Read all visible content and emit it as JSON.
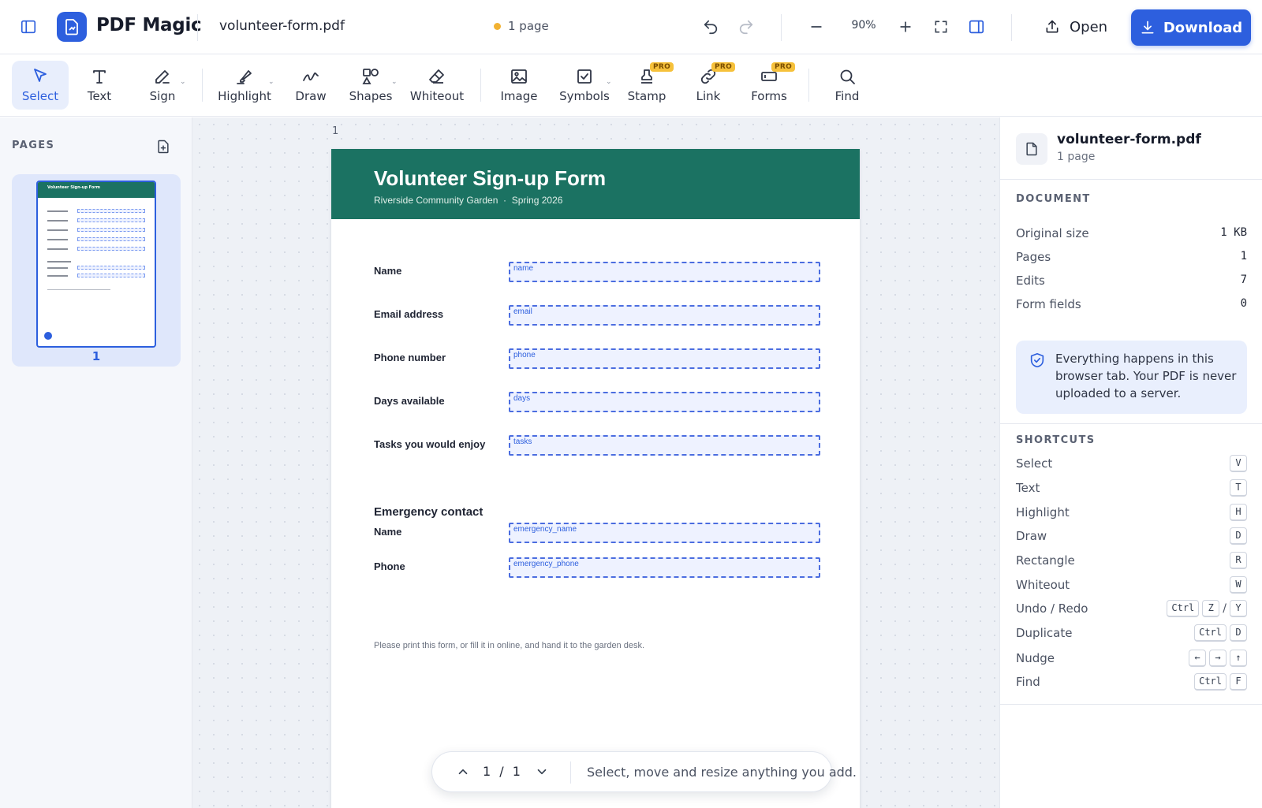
{
  "app": {
    "name": "PDF Magic"
  },
  "header": {
    "file_name": "volunteer-form.pdf",
    "page_status": "1 page",
    "zoom_level": "90%",
    "open_label": "Open",
    "download_label": "Download",
    "status_color": "#f2b232",
    "accent_color": "#2d5fde"
  },
  "toolbar": {
    "tools": [
      {
        "label": "Select",
        "icon": "cursor-icon"
      },
      {
        "label": "Text",
        "icon": "text-icon"
      },
      {
        "label": "Sign",
        "icon": "pen-icon"
      },
      {
        "label": "Highlight",
        "icon": "highlighter-icon"
      },
      {
        "label": "Draw",
        "icon": "squiggle-icon"
      },
      {
        "label": "Shapes",
        "icon": "shapes-icon"
      },
      {
        "label": "Whiteout",
        "icon": "eraser-icon"
      },
      {
        "label": "Image",
        "icon": "image-icon"
      },
      {
        "label": "Symbols",
        "icon": "checkbox-icon"
      },
      {
        "label": "Stamp",
        "icon": "stamp-icon"
      },
      {
        "label": "Link",
        "icon": "link-icon"
      },
      {
        "label": "Forms",
        "icon": "form-icon"
      },
      {
        "label": "Find",
        "icon": "search-icon"
      }
    ],
    "pro_badge": "PRO"
  },
  "pages_panel": {
    "title": "PAGES",
    "thumbnail_title": "Volunteer Sign-up Form",
    "page_number": "1"
  },
  "canvas": {
    "page_index": "1",
    "pager_counter": "1 / 1",
    "pager_hint": "Select, move and resize anything you add."
  },
  "document": {
    "title": "Volunteer Sign-up Form",
    "subtitle": "Riverside Community Garden  ·  Spring 2026",
    "header_color": "#1b7262",
    "fields": [
      {
        "label": "Name",
        "field": "name"
      },
      {
        "label": "Email address",
        "field": "email"
      },
      {
        "label": "Phone number",
        "field": "phone"
      },
      {
        "label": "Days available",
        "field": "days"
      },
      {
        "label": "Tasks you would enjoy",
        "field": "tasks"
      }
    ],
    "emergency_heading": "Emergency contact",
    "emergency_fields": [
      {
        "label": "Name",
        "field": "emergency_name"
      },
      {
        "label": "Phone",
        "field": "emergency_phone"
      }
    ],
    "footer": "Please print this form, or fill it in online, and hand it to the garden desk."
  },
  "info_panel": {
    "file_name": "volunteer-form.pdf",
    "page_count": "1 page",
    "document_heading": "DOCUMENT",
    "document_stats": [
      {
        "key": "Original size",
        "value": "1 KB"
      },
      {
        "key": "Pages",
        "value": "1"
      },
      {
        "key": "Edits",
        "value": "7"
      },
      {
        "key": "Form fields",
        "value": "0"
      }
    ],
    "privacy_note": "Everything happens in this browser tab. Your PDF is never uploaded to a server.",
    "shortcuts_heading": "SHORTCUTS",
    "shortcuts": [
      {
        "action": "Select",
        "keys": [
          "V"
        ]
      },
      {
        "action": "Text",
        "keys": [
          "T"
        ]
      },
      {
        "action": "Highlight",
        "keys": [
          "H"
        ]
      },
      {
        "action": "Draw",
        "keys": [
          "D"
        ]
      },
      {
        "action": "Rectangle",
        "keys": [
          "R"
        ]
      },
      {
        "action": "Whiteout",
        "keys": [
          "W"
        ]
      },
      {
        "action": "Undo / Redo",
        "keys": [
          "Ctrl",
          "Z",
          "/",
          "Y"
        ]
      },
      {
        "action": "Duplicate",
        "keys": [
          "Ctrl",
          "D"
        ]
      },
      {
        "action": "Nudge",
        "keys": [
          "←",
          "→",
          "↑"
        ]
      },
      {
        "action": "Find",
        "keys": [
          "Ctrl",
          "F"
        ]
      }
    ]
  }
}
